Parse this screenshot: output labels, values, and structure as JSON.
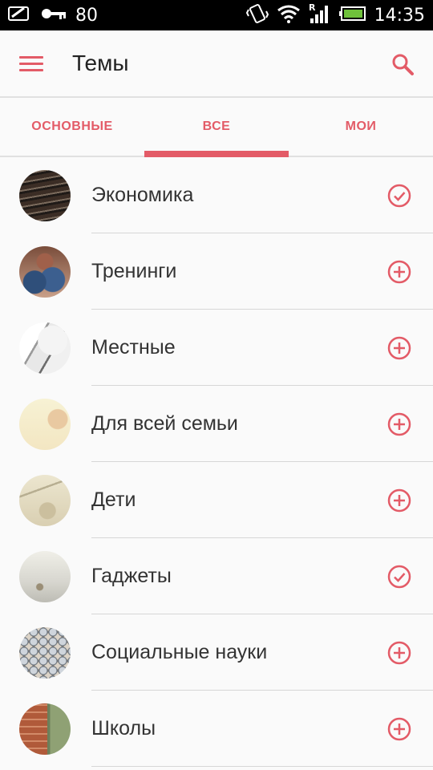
{
  "status_bar": {
    "left_icons": [
      "wallet-icon",
      "key-icon"
    ],
    "battery_percent_text": "80",
    "right_icons": [
      "vibrate-icon",
      "wifi-icon",
      "signal-icon",
      "battery-icon"
    ],
    "roaming_letter": "R",
    "time": "14:35"
  },
  "app_bar": {
    "title": "Темы",
    "menu_icon": "menu-icon",
    "search_icon": "search-icon",
    "accent_color": "#e35b67"
  },
  "tabs": [
    {
      "label": "ОСНОВНЫЕ",
      "active": false
    },
    {
      "label": "ВСЕ",
      "active": true
    },
    {
      "label": "МОИ",
      "active": false
    }
  ],
  "topics": [
    {
      "name": "Экономика",
      "subscribed": true
    },
    {
      "name": "Тренинги",
      "subscribed": false
    },
    {
      "name": "Местные",
      "subscribed": false
    },
    {
      "name": "Для всей семьи",
      "subscribed": false
    },
    {
      "name": "Дети",
      "subscribed": false
    },
    {
      "name": "Гаджеты",
      "subscribed": true
    },
    {
      "name": "Социальные науки",
      "subscribed": false
    },
    {
      "name": "Школы",
      "subscribed": false
    }
  ]
}
